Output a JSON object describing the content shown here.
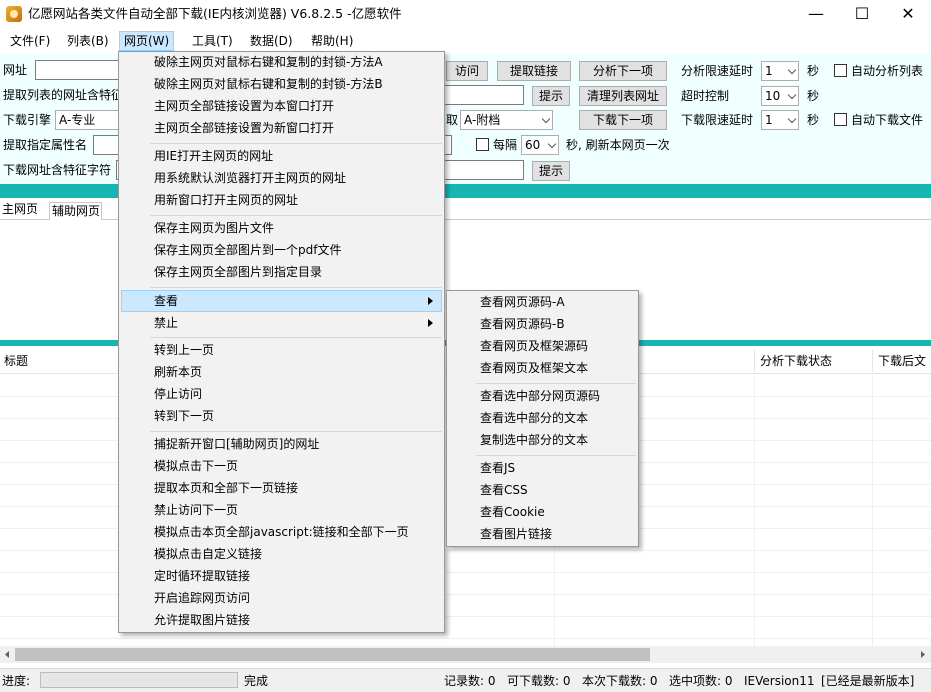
{
  "window": {
    "title": "亿愿网站各类文件自动全部下载(IE内核浏览器) V6.8.2.5 -亿愿软件",
    "minimize": "—",
    "maximize": "☐",
    "close": "✕"
  },
  "menubar": {
    "file": "文件(F)",
    "list": "列表(B)",
    "webpage": "网页(W)",
    "tools": "工具(T)",
    "data": "数据(D)",
    "help": "帮助(H)"
  },
  "toolbar": {
    "url_label": "网址",
    "list_url_label": "提取列表的网址含特征",
    "engine_label": "下载引擎",
    "engine_value": "A-专业",
    "attr_label": "提取指定属性名",
    "feature_label": "下载网址含特征字符",
    "visit": "访问",
    "extract_links": "提取链接",
    "analyze_next": "分析下一项",
    "analyze_delay_label": "分析限速延时",
    "analyze_delay_value": "1",
    "seconds": "秒",
    "auto_analyze": "自动分析列表",
    "prompt": "提示",
    "clear_list_url": "清理列表网址",
    "timeout_label": "超时控制",
    "timeout_value": "10",
    "fetch_suffix": "取",
    "attach_value": "A-附档",
    "download_next": "下载下一项",
    "download_delay_label": "下载限速延时",
    "download_delay_value": "1",
    "auto_download": "自动下载文件",
    "every": "每隔",
    "interval_value": "60",
    "refresh_text": "秒, 刷新本网页一次",
    "prompt2": "提示"
  },
  "tabs": {
    "main": "主网页",
    "aux": "辅助网页"
  },
  "list": {
    "col_title": "标题",
    "col_status": "分析下载状态",
    "col_after": "下载后文"
  },
  "statusbar": {
    "progress_label": "进度:",
    "done": "完成",
    "records": "记录数: 0",
    "downloadable": "可下载数: 0",
    "this_download": "本次下载数: 0",
    "selected": "选中项数: 0",
    "ie_version": "IEVersion11",
    "latest": "[已经是最新版本]"
  },
  "webpage_menu": {
    "items": [
      "破除主网页对鼠标右键和复制的封锁-方法A",
      "破除主网页对鼠标右键和复制的封锁-方法B",
      "主网页全部链接设置为本窗口打开",
      "主网页全部链接设置为新窗口打开",
      "用IE打开主网页的网址",
      "用系统默认浏览器打开主网页的网址",
      "用新窗口打开主网页的网址",
      "保存主网页为图片文件",
      "保存主网页全部图片到一个pdf文件",
      "保存主网页全部图片到指定目录",
      "查看",
      "禁止",
      "转到上一页",
      "刷新本页",
      "停止访问",
      "转到下一页",
      "捕捉新开窗口[辅助网页]的网址",
      "模拟点击下一页",
      "提取本页和全部下一页链接",
      "禁止访问下一页",
      "模拟点击本页全部javascript:链接和全部下一页",
      "模拟点击自定义链接",
      "定时循环提取链接",
      "开启追踪网页访问",
      "允许提取图片链接"
    ]
  },
  "view_submenu": {
    "items": [
      "查看网页源码-A",
      "查看网页源码-B",
      "查看网页及框架源码",
      "查看网页及框架文本",
      "查看选中部分网页源码",
      "查看选中部分的文本",
      "复制选中部分的文本",
      "查看JS",
      "查看CSS",
      "查看Cookie",
      "查看图片链接"
    ]
  }
}
